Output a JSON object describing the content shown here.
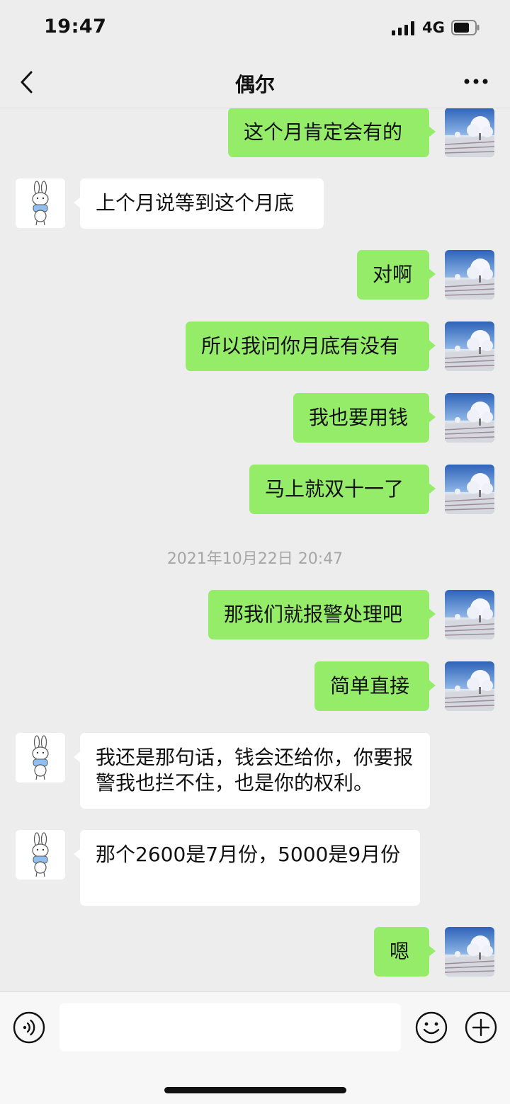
{
  "status_bar": {
    "time": "19:47",
    "network": "4G"
  },
  "nav": {
    "title": "偶尔"
  },
  "messages": [
    {
      "from": "me",
      "text": "这个月肯定会有的"
    },
    {
      "from": "them",
      "text": "上个月说等到这个月底"
    },
    {
      "from": "me",
      "text": "对啊"
    },
    {
      "from": "me",
      "text": "所以我问你月底有没有"
    },
    {
      "from": "me",
      "text": "我也要用钱"
    },
    {
      "from": "me",
      "text": "马上就双十一了"
    },
    {
      "from": "me",
      "text": "那我们就报警处理吧"
    },
    {
      "from": "me",
      "text": "简单直接"
    },
    {
      "from": "them",
      "text": "我还是那句话，钱会还给你，你要报警我也拦不住，也是你的权利。"
    },
    {
      "from": "them",
      "text": "那个2600是7月份，5000是9月份"
    },
    {
      "from": "me",
      "text": "嗯"
    }
  ],
  "timestamp": "2021年10月22日 20:47",
  "icons": {
    "me_avatar": "snowy-tree-avatar",
    "them_avatar": "bunny-avatar",
    "back": "chevron-left-icon",
    "more": "more-dots-icon",
    "voice": "voice-icon",
    "emoji": "emoji-icon",
    "plus": "plus-icon"
  },
  "colors": {
    "bubble_me": "#95ec69",
    "bubble_them": "#ffffff",
    "background": "#ededed"
  }
}
